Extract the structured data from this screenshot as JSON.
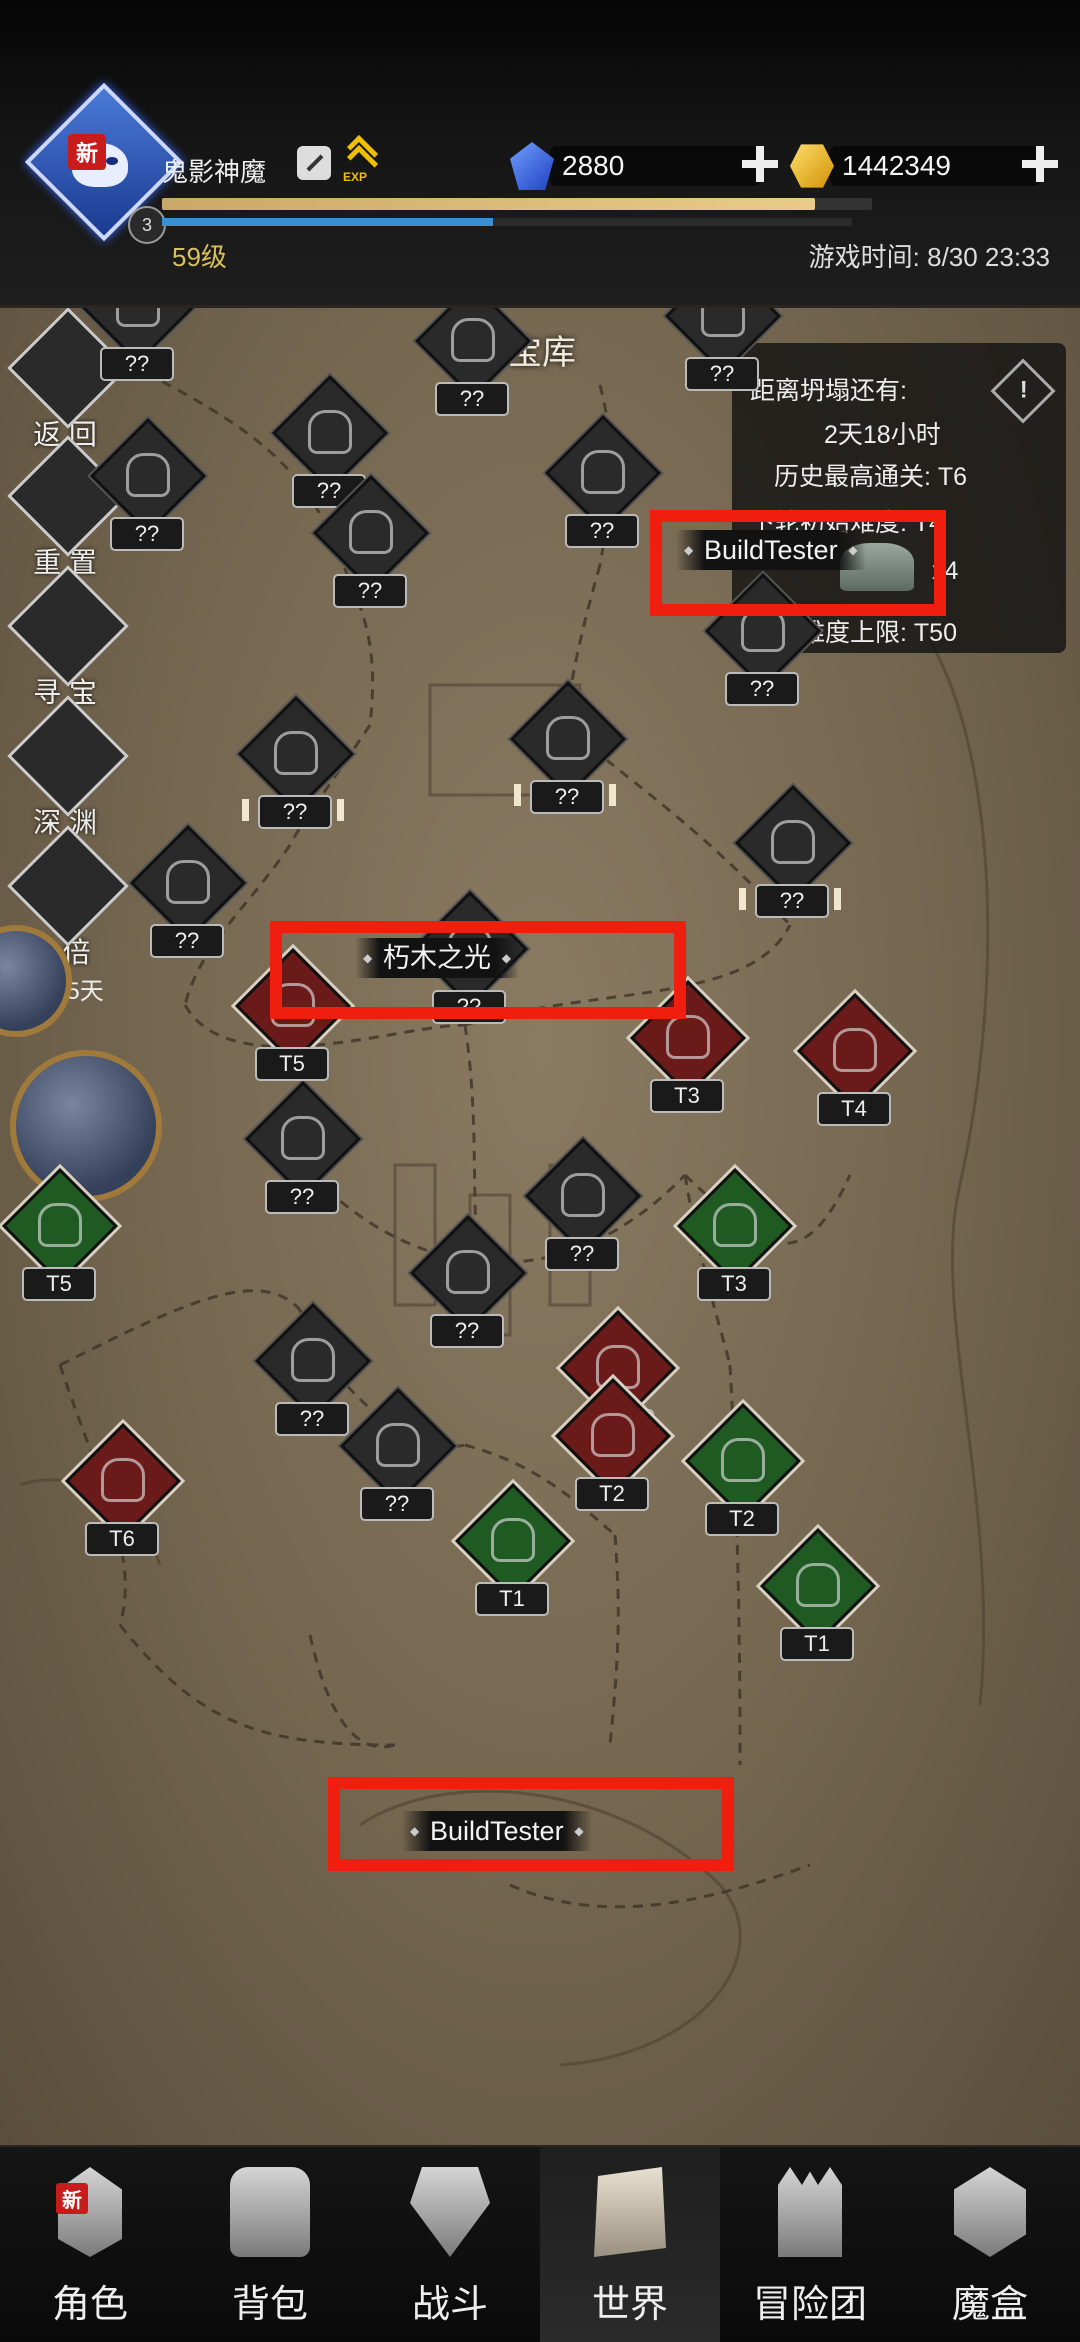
{
  "hud": {
    "player_name": "鬼影神魔",
    "avatar_new_badge": "新",
    "avatar_small_number": "3",
    "exp_icon_text": "EXP",
    "level_text": "59级",
    "game_time": "游戏时间: 8/30 23:33",
    "xp_progress_fraction": 0.92,
    "mp_progress_fraction": 0.48,
    "gems": "2880",
    "gold": "1442349"
  },
  "map": {
    "title": "万神宝库",
    "side_buttons": {
      "back": "返 回",
      "reset": "重 置",
      "treasure": "寻 宝",
      "abyss": "深 渊",
      "double": "2 倍",
      "double_days": "3295天"
    },
    "info_panel": {
      "collapse_label": "距离坍塌还有:",
      "collapse_time": "2天18小时",
      "best_clear": "历史最高通关: T6",
      "next_start": "下轮初始难度: T4",
      "relic_count": "x4",
      "difficulty_cap": "当前难度上限: T50",
      "warn_symbol": "!"
    },
    "nodes": [
      {
        "label": "??",
        "style": "dark"
      },
      {
        "label": "??",
        "style": "dark"
      },
      {
        "label": "??",
        "style": "dark"
      },
      {
        "label": "??",
        "style": "dark"
      },
      {
        "label": "??",
        "style": "dark"
      },
      {
        "label": "??",
        "style": "dark"
      },
      {
        "label": "??",
        "style": "dark"
      },
      {
        "label": "??",
        "style": "dark"
      },
      {
        "label": "??",
        "style": "dark"
      },
      {
        "label": "??",
        "style": "dark"
      },
      {
        "label": "??",
        "style": "dark"
      },
      {
        "label": "??",
        "style": "dark"
      },
      {
        "label": "??",
        "style": "dark"
      },
      {
        "label": "??",
        "style": "dark"
      },
      {
        "label": "T5",
        "style": "red"
      },
      {
        "label": "T3",
        "style": "red"
      },
      {
        "label": "T4",
        "style": "red"
      },
      {
        "label": "T5",
        "style": "green"
      },
      {
        "label": "??",
        "style": "dark"
      },
      {
        "label": "T3",
        "style": "green"
      },
      {
        "label": "??",
        "style": "dark"
      },
      {
        "label": "T3",
        "style": "red"
      },
      {
        "label": "??",
        "style": "dark"
      },
      {
        "label": "T6",
        "style": "red"
      },
      {
        "label": "??",
        "style": "dark"
      },
      {
        "label": "T2",
        "style": "red"
      },
      {
        "label": "T2",
        "style": "green"
      },
      {
        "label": "T1",
        "style": "green"
      },
      {
        "label": "T1",
        "style": "green"
      }
    ],
    "highlight_tags": [
      "BuildTester",
      "朽木之光",
      "BuildTester"
    ]
  },
  "nav": {
    "items": [
      "角色",
      "背包",
      "战斗",
      "世界",
      "冒险团",
      "魔盒"
    ],
    "active_index": 3,
    "role_new_badge": "新"
  }
}
